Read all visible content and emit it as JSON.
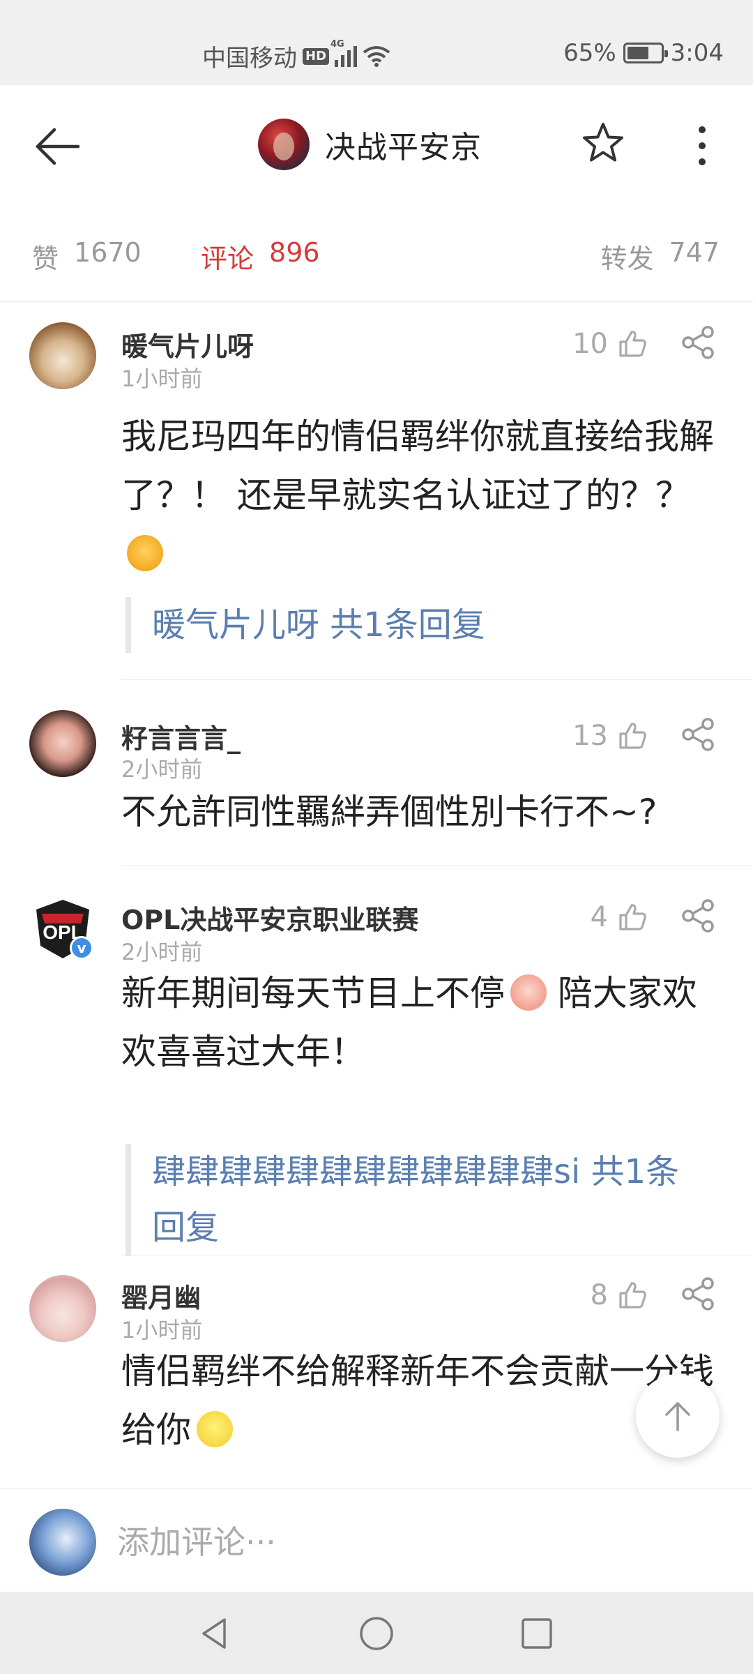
{
  "status_bar": {
    "carrier": "中国移动",
    "hd": "HD",
    "network": "4G",
    "battery_percent": "65%",
    "battery_level": 0.65,
    "time": "3:04"
  },
  "header": {
    "title": "决战平安京"
  },
  "tabs": {
    "likes_label": "赞",
    "likes_count": "1670",
    "comments_label": "评论",
    "comments_count": "896",
    "reposts_label": "转发",
    "reposts_count": "747"
  },
  "comments": [
    {
      "username": "暖气片儿呀",
      "time": "1小时前",
      "likes": "10",
      "content": "我尼玛四年的情侣羁绊你就直接给我解了？！ 还是早就实名认证过了的？？",
      "reply": "暖气片儿呀 共1条回复"
    },
    {
      "username": "籽言言言_",
      "time": "2小时前",
      "likes": "13",
      "content": "不允許同性羈絆弄個性別卡行不~?"
    },
    {
      "username": "OPL决战平安京职业联赛",
      "time": "2小时前",
      "likes": "4",
      "content_part1": "新年期间每天节目上不停",
      "content_part2": " 陪大家欢欢喜喜过大年！",
      "reply": "肆肆肆肆肆肆肆肆肆肆肆肆si 共1条回复",
      "avatar_text": "OPL"
    },
    {
      "username": "罂月幽",
      "time": "1小时前",
      "likes": "8",
      "content": "情侣羁绊不给解释新年不会贡献一分钱给你"
    }
  ],
  "input": {
    "placeholder": "添加评论···"
  },
  "icons": {
    "back": "arrow-left-icon",
    "star": "star-outline-icon",
    "more": "more-vertical-icon",
    "like": "thumbs-up-icon",
    "share": "share-icon",
    "scroll_top": "arrow-up-icon"
  },
  "colors": {
    "accent_red": "#d83a3a",
    "link_blue": "#5a7fb0"
  }
}
